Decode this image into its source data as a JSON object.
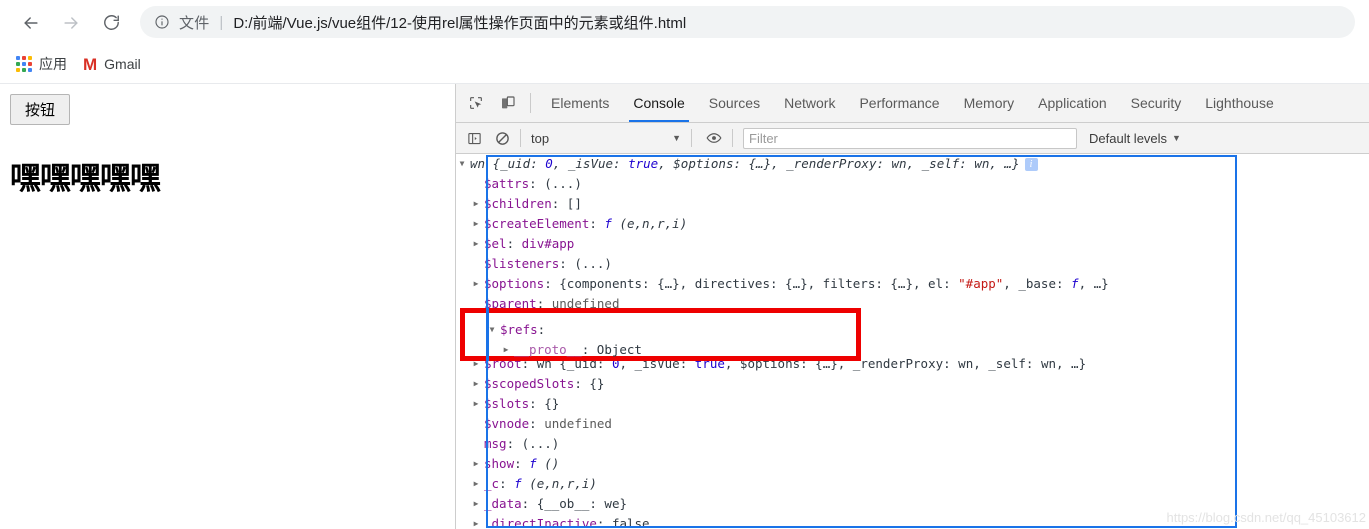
{
  "browser": {
    "nav": {
      "back_label": "Back",
      "forward_label": "Forward",
      "reload_label": "Reload"
    },
    "omnibox": {
      "scheme_label": "文件",
      "separator": "|",
      "url": "D:/前端/Vue.js/vue组件/12-使用rel属性操作页面中的元素或组件.html"
    },
    "bookmarks": [
      {
        "label": "应用",
        "icon": "apps-grid-icon"
      },
      {
        "label": "Gmail",
        "icon": "gmail-icon"
      }
    ]
  },
  "page": {
    "button_label": "按钮",
    "heading": "嘿嘿嘿嘿嘿"
  },
  "devtools": {
    "panel_icons": [
      {
        "name": "inspect-element-icon"
      },
      {
        "name": "device-toolbar-icon"
      }
    ],
    "tabs": [
      {
        "label": "Elements",
        "active": false
      },
      {
        "label": "Console",
        "active": true
      },
      {
        "label": "Sources",
        "active": false
      },
      {
        "label": "Network",
        "active": false
      },
      {
        "label": "Performance",
        "active": false
      },
      {
        "label": "Memory",
        "active": false
      },
      {
        "label": "Application",
        "active": false
      },
      {
        "label": "Security",
        "active": false
      },
      {
        "label": "Lighthouse",
        "active": false
      }
    ],
    "console_toolbar": {
      "sidebar_icon": "console-sidebar-icon",
      "clear_icon": "clear-console-icon",
      "context": "top",
      "eye_icon": "live-expression-eye-icon",
      "filter_placeholder": "Filter",
      "filter_value": "",
      "levels_label": "Default levels",
      "caret": "▼"
    },
    "console_rows": [
      {
        "indent": 0,
        "arrow": "▼",
        "parts": [
          {
            "t": "wn ",
            "c": "k-dark k-ital"
          },
          {
            "t": "{",
            "c": "k-dark k-ital"
          },
          {
            "t": "_uid",
            "c": "k-dark k-ital"
          },
          {
            "t": ": ",
            "c": "k-dark k-ital"
          },
          {
            "t": "0",
            "c": "k-num k-ital"
          },
          {
            "t": ", ",
            "c": "k-dark k-ital"
          },
          {
            "t": "_isVue",
            "c": "k-dark k-ital"
          },
          {
            "t": ": ",
            "c": "k-dark k-ital"
          },
          {
            "t": "true",
            "c": "k-bool k-ital"
          },
          {
            "t": ", ",
            "c": "k-dark k-ital"
          },
          {
            "t": "$options",
            "c": "k-dark k-ital"
          },
          {
            "t": ": {…}, ",
            "c": "k-dark k-ital"
          },
          {
            "t": "_renderProxy",
            "c": "k-dark k-ital"
          },
          {
            "t": ": wn, ",
            "c": "k-dark k-ital"
          },
          {
            "t": "_self",
            "c": "k-dark k-ital"
          },
          {
            "t": ": wn, …}",
            "c": "k-dark k-ital"
          }
        ],
        "badge": "i"
      },
      {
        "indent": 1,
        "arrow": "",
        "parts": [
          {
            "t": "$attrs",
            "c": "k-name"
          },
          {
            "t": ": ",
            "c": "k-dark"
          },
          {
            "t": "(...)",
            "c": "k-dark"
          }
        ]
      },
      {
        "indent": 1,
        "arrow": "▶",
        "parts": [
          {
            "t": "$children",
            "c": "k-name"
          },
          {
            "t": ": ",
            "c": "k-dark"
          },
          {
            "t": "[]",
            "c": "k-dark"
          }
        ]
      },
      {
        "indent": 1,
        "arrow": "▶",
        "parts": [
          {
            "t": "$createElement",
            "c": "k-name"
          },
          {
            "t": ": ",
            "c": "k-dark"
          },
          {
            "t": "f ",
            "c": "k-fn"
          },
          {
            "t": "(e,n,r,i)",
            "c": "k-dark k-ital"
          }
        ]
      },
      {
        "indent": 1,
        "arrow": "▶",
        "parts": [
          {
            "t": "$el",
            "c": "k-name"
          },
          {
            "t": ": ",
            "c": "k-dark"
          },
          {
            "t": "div#app",
            "c": "k-name"
          }
        ]
      },
      {
        "indent": 1,
        "arrow": "",
        "parts": [
          {
            "t": "$listeners",
            "c": "k-name"
          },
          {
            "t": ": ",
            "c": "k-dark"
          },
          {
            "t": "(...)",
            "c": "k-dark"
          }
        ]
      },
      {
        "indent": 1,
        "arrow": "▶",
        "parts": [
          {
            "t": "$options",
            "c": "k-name"
          },
          {
            "t": ": {components: {…}, directives: {…}, filters: {…}, el: ",
            "c": "k-dark"
          },
          {
            "t": "\"#app\"",
            "c": "k-str"
          },
          {
            "t": ", _base: ",
            "c": "k-dark"
          },
          {
            "t": "f",
            "c": "k-fn"
          },
          {
            "t": ", …}",
            "c": "k-dark"
          }
        ]
      },
      {
        "indent": 1,
        "arrow": "",
        "parts": [
          {
            "t": "$parent",
            "c": "k-name"
          },
          {
            "t": ": ",
            "c": "k-dark"
          },
          {
            "t": "undefined",
            "c": "k-gray"
          }
        ]
      },
      {
        "indent": 1,
        "arrow": "▼",
        "parts": [
          {
            "t": "$refs",
            "c": "k-name"
          },
          {
            "t": ":",
            "c": "k-dark"
          }
        ]
      },
      {
        "indent": 2,
        "arrow": "▶",
        "parts": [
          {
            "t": "__proto__",
            "c": "k-proto"
          },
          {
            "t": ": ",
            "c": "k-dark"
          },
          {
            "t": "Object",
            "c": "k-dark"
          }
        ]
      },
      {
        "indent": 1,
        "arrow": "▶",
        "parts": [
          {
            "t": "$root",
            "c": "k-name"
          },
          {
            "t": ": wn {",
            "c": "k-dark"
          },
          {
            "t": "_uid",
            "c": "k-dark"
          },
          {
            "t": ": ",
            "c": "k-dark"
          },
          {
            "t": "0",
            "c": "k-num"
          },
          {
            "t": ", _isVue: ",
            "c": "k-dark"
          },
          {
            "t": "true",
            "c": "k-bool"
          },
          {
            "t": ", $options: {…}, _renderProxy: wn, _self: wn, …}",
            "c": "k-dark"
          }
        ]
      },
      {
        "indent": 1,
        "arrow": "▶",
        "parts": [
          {
            "t": "$scopedSlots",
            "c": "k-name"
          },
          {
            "t": ": ",
            "c": "k-dark"
          },
          {
            "t": "{}",
            "c": "k-dark"
          }
        ]
      },
      {
        "indent": 1,
        "arrow": "▶",
        "parts": [
          {
            "t": "$slots",
            "c": "k-name"
          },
          {
            "t": ": ",
            "c": "k-dark"
          },
          {
            "t": "{}",
            "c": "k-dark"
          }
        ]
      },
      {
        "indent": 1,
        "arrow": "",
        "parts": [
          {
            "t": "$vnode",
            "c": "k-name"
          },
          {
            "t": ": ",
            "c": "k-dark"
          },
          {
            "t": "undefined",
            "c": "k-gray"
          }
        ]
      },
      {
        "indent": 1,
        "arrow": "",
        "parts": [
          {
            "t": "msg",
            "c": "k-name"
          },
          {
            "t": ": ",
            "c": "k-dark"
          },
          {
            "t": "(...)",
            "c": "k-dark"
          }
        ]
      },
      {
        "indent": 1,
        "arrow": "▶",
        "parts": [
          {
            "t": "show",
            "c": "k-name"
          },
          {
            "t": ": ",
            "c": "k-dark"
          },
          {
            "t": "f ",
            "c": "k-fn"
          },
          {
            "t": "()",
            "c": "k-dark k-ital"
          }
        ]
      },
      {
        "indent": 1,
        "arrow": "▶",
        "parts": [
          {
            "t": "_c",
            "c": "k-name"
          },
          {
            "t": ": ",
            "c": "k-dark"
          },
          {
            "t": "f ",
            "c": "k-fn"
          },
          {
            "t": "(e,n,r,i)",
            "c": "k-dark k-ital"
          }
        ]
      },
      {
        "indent": 1,
        "arrow": "▶",
        "parts": [
          {
            "t": "_data",
            "c": "k-name"
          },
          {
            "t": ": {__ob__: we}",
            "c": "k-dark"
          }
        ]
      },
      {
        "indent": 1,
        "arrow": "▶",
        "parts": [
          {
            "t": "_directInactive",
            "c": "k-name"
          },
          {
            "t": ": false",
            "c": "k-dark"
          }
        ]
      }
    ],
    "highlight_box": {
      "rows": [
        {
          "deep": false,
          "arrow": "▼",
          "parts": [
            {
              "t": "$refs",
              "c": "k-name"
            },
            {
              "t": ":",
              "c": "k-dark"
            }
          ]
        },
        {
          "deep": true,
          "arrow": "▶",
          "parts": [
            {
              "t": "__proto__",
              "c": "k-proto"
            },
            {
              "t": ": ",
              "c": "k-dark"
            },
            {
              "t": "Object",
              "c": "k-dark"
            }
          ]
        }
      ]
    },
    "watermark": "https://blog.csdn.net/qq_45103612"
  },
  "colors": {
    "accent_blue": "#1a73e8",
    "highlight_red": "#ee0000",
    "toolbar_bg": "#f3f3f3",
    "omnibox_bg": "#f1f3f4"
  }
}
